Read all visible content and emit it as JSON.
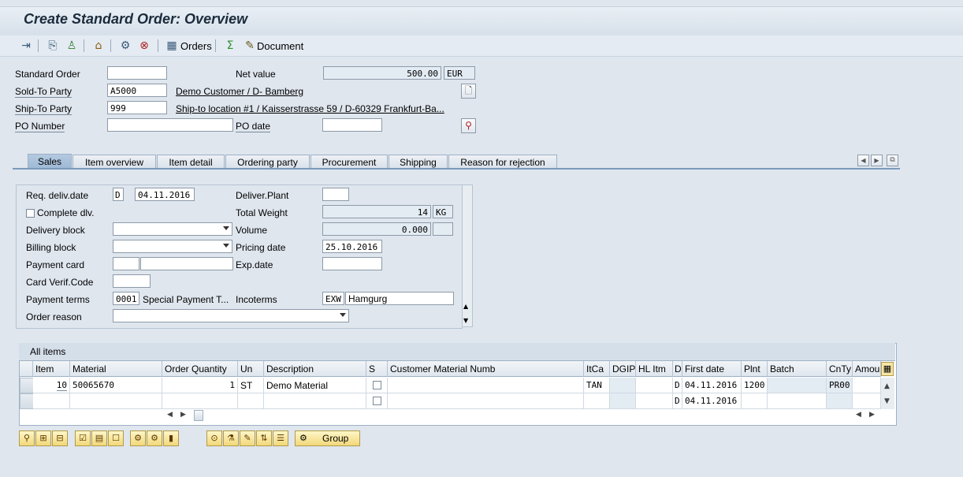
{
  "window": {
    "title": "Create Standard Order: Overview"
  },
  "toolbar": {
    "orders_label": "Orders",
    "document_label": "Document",
    "icons": [
      "display-doc-icon",
      "copy-icon",
      "person-icon",
      "home-icon",
      "pricing-icon",
      "delete-icon",
      "orders-icon",
      "refresh-icon",
      "document-icon"
    ]
  },
  "header": {
    "standard_order": {
      "label": "Standard Order",
      "value": ""
    },
    "net_value": {
      "label": "Net value",
      "value": "500.00",
      "currency": "EUR"
    },
    "sold_to": {
      "label": "Sold-To Party",
      "value": "A5000",
      "desc": "Demo Customer / D- Bamberg"
    },
    "ship_to": {
      "label": "Ship-To Party",
      "value": "999",
      "desc": "Ship-to location #1 / Kaisserstrasse 59 / D-60329 Frankfurt-Ba..."
    },
    "po_number": {
      "label": "PO Number",
      "value": ""
    },
    "po_date": {
      "label": "PO date",
      "value": ""
    }
  },
  "tabs": [
    {
      "label": "Sales",
      "active": true
    },
    {
      "label": "Item overview",
      "active": false
    },
    {
      "label": "Item detail",
      "active": false
    },
    {
      "label": "Ordering party",
      "active": false
    },
    {
      "label": "Procurement",
      "active": false
    },
    {
      "label": "Shipping",
      "active": false
    },
    {
      "label": "Reason for rejection",
      "active": false
    }
  ],
  "sales": {
    "req_deliv_date": {
      "label": "Req. deliv.date",
      "format": "D",
      "value": "04.11.2016"
    },
    "deliver_plant": {
      "label": "Deliver.Plant",
      "value": ""
    },
    "complete_dlv": {
      "label": "Complete dlv.",
      "checked": false
    },
    "total_weight": {
      "label": "Total Weight",
      "value": "14",
      "unit": "KG"
    },
    "delivery_block": {
      "label": "Delivery block",
      "value": ""
    },
    "volume": {
      "label": "Volume",
      "value": "0.000",
      "unit": ""
    },
    "billing_block": {
      "label": "Billing block",
      "value": ""
    },
    "pricing_date": {
      "label": "Pricing date",
      "value": "25.10.2016"
    },
    "payment_card": {
      "label": "Payment card",
      "value1": "",
      "value2": ""
    },
    "exp_date": {
      "label": "Exp.date",
      "value": ""
    },
    "card_verif": {
      "label": "Card Verif.Code",
      "value": ""
    },
    "payment_terms": {
      "label": "Payment terms",
      "value": "0001",
      "desc": "Special Payment T..."
    },
    "incoterms": {
      "label": "Incoterms",
      "value": "EXW",
      "desc": "Hamgurg"
    },
    "order_reason": {
      "label": "Order reason",
      "value": ""
    }
  },
  "items_table": {
    "title": "All items",
    "columns": [
      "Item",
      "Material",
      "Order Quantity",
      "Un",
      "Description",
      "S",
      "Customer Material Numb",
      "ItCa",
      "DGIP",
      "HL Itm",
      "D",
      "First date",
      "Plnt",
      "Batch",
      "CnTy",
      "Amou"
    ],
    "rows": [
      {
        "item": "10",
        "material": "50065670",
        "qty": "1",
        "un": "ST",
        "desc": "Demo Material",
        "cust_mat": "",
        "itca": "TAN",
        "d": "D",
        "first_date": "04.11.2016",
        "plnt": "1200",
        "batch": "",
        "cnty": "PR00"
      },
      {
        "item": "",
        "material": "",
        "qty": "",
        "un": "",
        "desc": "",
        "cust_mat": "",
        "itca": "",
        "d": "D",
        "first_date": "04.11.2016",
        "plnt": "",
        "batch": "",
        "cnty": ""
      }
    ]
  },
  "bottom": {
    "group_label": "Group"
  }
}
